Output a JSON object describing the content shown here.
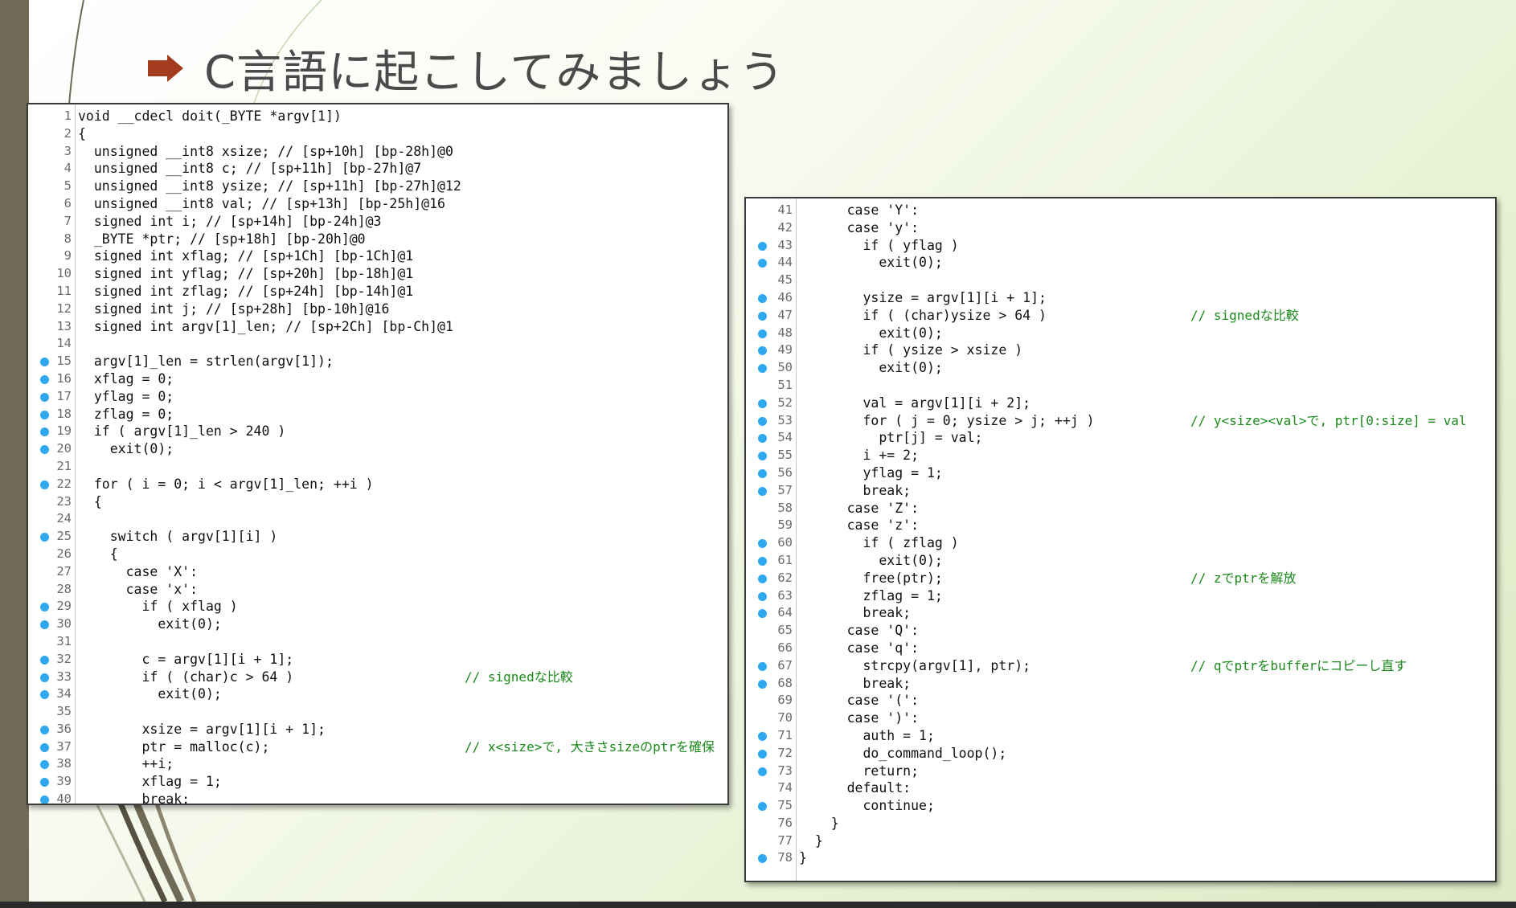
{
  "slide": {
    "title": "C言語に起こしてみましょう",
    "accent_color": "#a33b1f",
    "bullet_icon": "right-arrow-icon"
  },
  "code_panels": [
    {
      "name": "left",
      "lines": [
        {
          "n": "1",
          "bp": false,
          "code": "void __cdecl doit(_BYTE *argv[1])",
          "comment": ""
        },
        {
          "n": "2",
          "bp": false,
          "code": "{",
          "comment": ""
        },
        {
          "n": "3",
          "bp": false,
          "code": "  unsigned __int8 xsize; // [sp+10h] [bp-28h]@0",
          "comment": ""
        },
        {
          "n": "4",
          "bp": false,
          "code": "  unsigned __int8 c; // [sp+11h] [bp-27h]@7",
          "comment": ""
        },
        {
          "n": "5",
          "bp": false,
          "code": "  unsigned __int8 ysize; // [sp+11h] [bp-27h]@12",
          "comment": ""
        },
        {
          "n": "6",
          "bp": false,
          "code": "  unsigned __int8 val; // [sp+13h] [bp-25h]@16",
          "comment": ""
        },
        {
          "n": "7",
          "bp": false,
          "code": "  signed int i; // [sp+14h] [bp-24h]@3",
          "comment": ""
        },
        {
          "n": "8",
          "bp": false,
          "code": "  _BYTE *ptr; // [sp+18h] [bp-20h]@0",
          "comment": ""
        },
        {
          "n": "9",
          "bp": false,
          "code": "  signed int xflag; // [sp+1Ch] [bp-1Ch]@1",
          "comment": ""
        },
        {
          "n": "10",
          "bp": false,
          "code": "  signed int yflag; // [sp+20h] [bp-18h]@1",
          "comment": ""
        },
        {
          "n": "11",
          "bp": false,
          "code": "  signed int zflag; // [sp+24h] [bp-14h]@1",
          "comment": ""
        },
        {
          "n": "12",
          "bp": false,
          "code": "  signed int j; // [sp+28h] [bp-10h]@16",
          "comment": ""
        },
        {
          "n": "13",
          "bp": false,
          "code": "  signed int argv[1]_len; // [sp+2Ch] [bp-Ch]@1",
          "comment": ""
        },
        {
          "n": "14",
          "bp": false,
          "code": "",
          "comment": ""
        },
        {
          "n": "15",
          "bp": true,
          "code": "  argv[1]_len = strlen(argv[1]);",
          "comment": ""
        },
        {
          "n": "16",
          "bp": true,
          "code": "  xflag = 0;",
          "comment": ""
        },
        {
          "n": "17",
          "bp": true,
          "code": "  yflag = 0;",
          "comment": ""
        },
        {
          "n": "18",
          "bp": true,
          "code": "  zflag = 0;",
          "comment": ""
        },
        {
          "n": "19",
          "bp": true,
          "code": "  if ( argv[1]_len > 240 )",
          "comment": ""
        },
        {
          "n": "20",
          "bp": true,
          "code": "    exit(0);",
          "comment": ""
        },
        {
          "n": "21",
          "bp": false,
          "code": "",
          "comment": ""
        },
        {
          "n": "22",
          "bp": true,
          "code": "  for ( i = 0; i < argv[1]_len; ++i )",
          "comment": ""
        },
        {
          "n": "23",
          "bp": false,
          "code": "  {",
          "comment": ""
        },
        {
          "n": "24",
          "bp": false,
          "code": "",
          "comment": ""
        },
        {
          "n": "25",
          "bp": true,
          "code": "    switch ( argv[1][i] )",
          "comment": ""
        },
        {
          "n": "26",
          "bp": false,
          "code": "    {",
          "comment": ""
        },
        {
          "n": "27",
          "bp": false,
          "code": "      case 'X':",
          "comment": ""
        },
        {
          "n": "28",
          "bp": false,
          "code": "      case 'x':",
          "comment": ""
        },
        {
          "n": "29",
          "bp": true,
          "code": "        if ( xflag )",
          "comment": ""
        },
        {
          "n": "30",
          "bp": true,
          "code": "          exit(0);",
          "comment": ""
        },
        {
          "n": "31",
          "bp": false,
          "code": "",
          "comment": ""
        },
        {
          "n": "32",
          "bp": true,
          "code": "        c = argv[1][i + 1];",
          "comment": ""
        },
        {
          "n": "33",
          "bp": true,
          "code": "        if ( (char)c > 64 )",
          "comment": "// signedな比較"
        },
        {
          "n": "34",
          "bp": true,
          "code": "          exit(0);",
          "comment": ""
        },
        {
          "n": "35",
          "bp": false,
          "code": "",
          "comment": ""
        },
        {
          "n": "36",
          "bp": true,
          "code": "        xsize = argv[1][i + 1];",
          "comment": ""
        },
        {
          "n": "37",
          "bp": true,
          "code": "        ptr = malloc(c);",
          "comment": "// x<size>で, 大きさsizeのptrを確保"
        },
        {
          "n": "38",
          "bp": true,
          "code": "        ++i;",
          "comment": ""
        },
        {
          "n": "39",
          "bp": true,
          "code": "        xflag = 1;",
          "comment": ""
        },
        {
          "n": "40",
          "bp": true,
          "code": "        break;",
          "comment": ""
        }
      ]
    },
    {
      "name": "right",
      "lines": [
        {
          "n": "41",
          "bp": false,
          "code": "      case 'Y':",
          "comment": ""
        },
        {
          "n": "42",
          "bp": false,
          "code": "      case 'y':",
          "comment": ""
        },
        {
          "n": "43",
          "bp": true,
          "code": "        if ( yflag )",
          "comment": ""
        },
        {
          "n": "44",
          "bp": true,
          "code": "          exit(0);",
          "comment": ""
        },
        {
          "n": "45",
          "bp": false,
          "code": "",
          "comment": ""
        },
        {
          "n": "46",
          "bp": true,
          "code": "        ysize = argv[1][i + 1];",
          "comment": ""
        },
        {
          "n": "47",
          "bp": true,
          "code": "        if ( (char)ysize > 64 )",
          "comment": "// signedな比較"
        },
        {
          "n": "48",
          "bp": true,
          "code": "          exit(0);",
          "comment": ""
        },
        {
          "n": "49",
          "bp": true,
          "code": "        if ( ysize > xsize )",
          "comment": ""
        },
        {
          "n": "50",
          "bp": true,
          "code": "          exit(0);",
          "comment": ""
        },
        {
          "n": "51",
          "bp": false,
          "code": "",
          "comment": ""
        },
        {
          "n": "52",
          "bp": true,
          "code": "        val = argv[1][i + 2];",
          "comment": ""
        },
        {
          "n": "53",
          "bp": true,
          "code": "        for ( j = 0; ysize > j; ++j )",
          "comment": "// y<size><val>で, ptr[0:size] = val"
        },
        {
          "n": "54",
          "bp": true,
          "code": "          ptr[j] = val;",
          "comment": ""
        },
        {
          "n": "55",
          "bp": true,
          "code": "        i += 2;",
          "comment": ""
        },
        {
          "n": "56",
          "bp": true,
          "code": "        yflag = 1;",
          "comment": ""
        },
        {
          "n": "57",
          "bp": true,
          "code": "        break;",
          "comment": ""
        },
        {
          "n": "58",
          "bp": false,
          "code": "      case 'Z':",
          "comment": ""
        },
        {
          "n": "59",
          "bp": false,
          "code": "      case 'z':",
          "comment": ""
        },
        {
          "n": "60",
          "bp": true,
          "code": "        if ( zflag )",
          "comment": ""
        },
        {
          "n": "61",
          "bp": true,
          "code": "          exit(0);",
          "comment": ""
        },
        {
          "n": "62",
          "bp": true,
          "code": "        free(ptr);",
          "comment": "// zでptrを解放"
        },
        {
          "n": "63",
          "bp": true,
          "code": "        zflag = 1;",
          "comment": ""
        },
        {
          "n": "64",
          "bp": true,
          "code": "        break;",
          "comment": ""
        },
        {
          "n": "65",
          "bp": false,
          "code": "      case 'Q':",
          "comment": ""
        },
        {
          "n": "66",
          "bp": false,
          "code": "      case 'q':",
          "comment": ""
        },
        {
          "n": "67",
          "bp": true,
          "code": "        strcpy(argv[1], ptr);",
          "comment": "// qでptrをbufferにコピーし直す"
        },
        {
          "n": "68",
          "bp": true,
          "code": "        break;",
          "comment": ""
        },
        {
          "n": "69",
          "bp": false,
          "code": "      case '(':",
          "comment": ""
        },
        {
          "n": "70",
          "bp": false,
          "code": "      case ')':",
          "comment": ""
        },
        {
          "n": "71",
          "bp": true,
          "code": "        auth = 1;",
          "comment": ""
        },
        {
          "n": "72",
          "bp": true,
          "code": "        do_command_loop();",
          "comment": ""
        },
        {
          "n": "73",
          "bp": true,
          "code": "        return;",
          "comment": ""
        },
        {
          "n": "74",
          "bp": false,
          "code": "      default:",
          "comment": ""
        },
        {
          "n": "75",
          "bp": true,
          "code": "        continue;",
          "comment": ""
        },
        {
          "n": "76",
          "bp": false,
          "code": "    }",
          "comment": ""
        },
        {
          "n": "77",
          "bp": false,
          "code": "  }",
          "comment": ""
        },
        {
          "n": "78",
          "bp": true,
          "code": "}",
          "comment": ""
        }
      ]
    }
  ]
}
